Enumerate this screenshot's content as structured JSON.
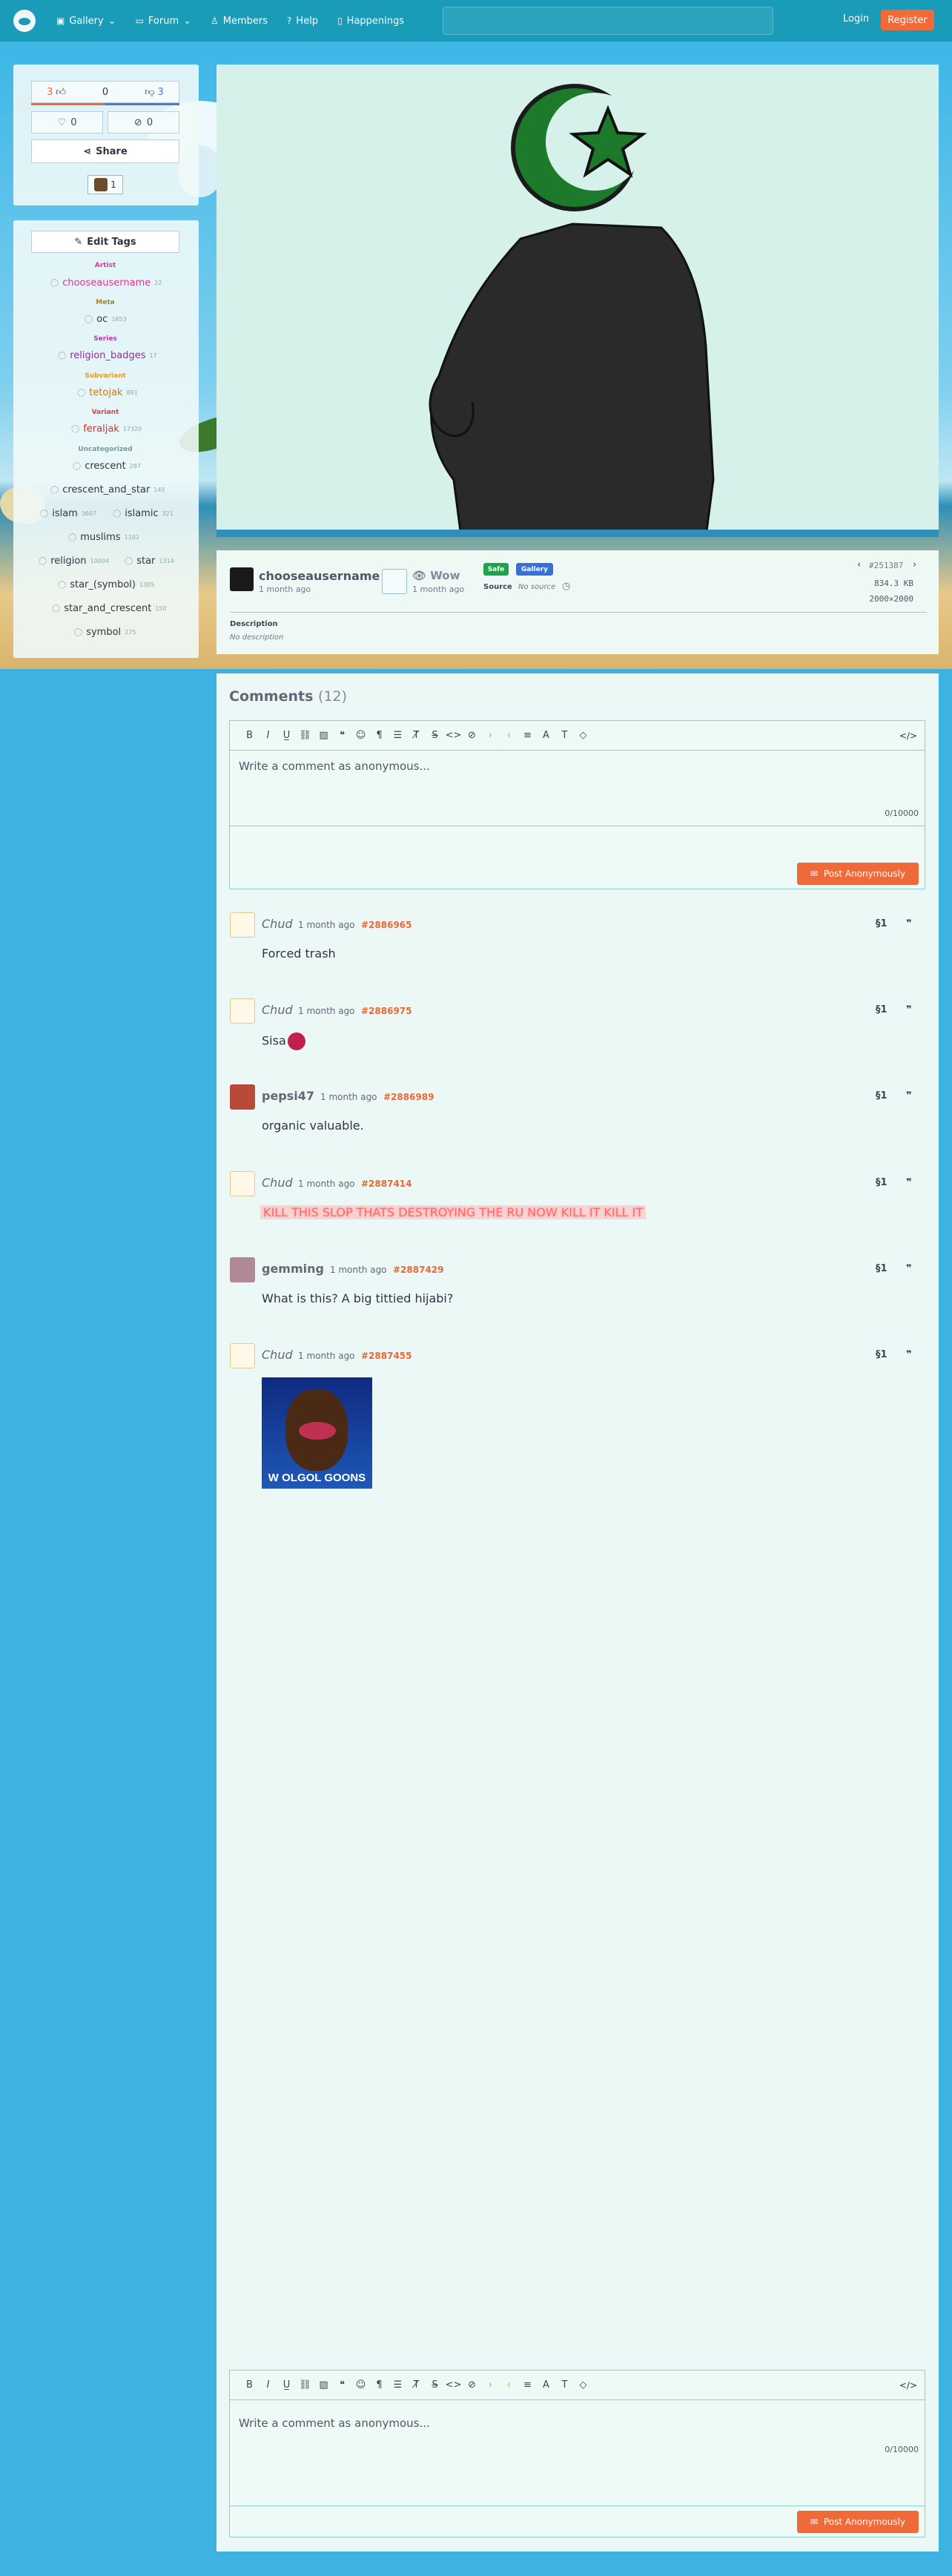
{
  "nav": {
    "items": [
      {
        "label": "Gallery",
        "icon": "image-icon",
        "dropdown": true
      },
      {
        "label": "Forum",
        "icon": "chat-icon",
        "dropdown": true
      },
      {
        "label": "Members",
        "icon": "user-icon"
      },
      {
        "label": "Help",
        "icon": "help-icon"
      },
      {
        "label": "Happenings",
        "icon": "book-icon"
      }
    ],
    "search_placeholder": "",
    "login": "Login",
    "register": "Register"
  },
  "votes": {
    "up": "3",
    "score": "0",
    "down": "3",
    "favorites": "0",
    "hides": "0"
  },
  "share": "Share",
  "favoriters_count": "1",
  "edit_tags": "Edit Tags",
  "tag_groups": [
    {
      "heading": "Artist",
      "color": "#e0339a",
      "tags": [
        {
          "name": "chooseausername",
          "count": "22",
          "color": "#e0339a"
        }
      ]
    },
    {
      "heading": "Meta",
      "color": "#a6822a",
      "tags": [
        {
          "name": "oc",
          "count": "1853",
          "color": "#334"
        }
      ]
    },
    {
      "heading": "Series",
      "color": "#b040b0",
      "tags": [
        {
          "name": "religion_badges",
          "count": "17",
          "color": "#903090"
        }
      ]
    },
    {
      "heading": "Subvariant",
      "color": "#e89a20",
      "tags": [
        {
          "name": "tetojak",
          "count": "891",
          "color": "#d07a10"
        }
      ]
    },
    {
      "heading": "Variant",
      "color": "#e04040",
      "tags": [
        {
          "name": "feraljak",
          "count": "17320",
          "color": "#d03030"
        }
      ]
    },
    {
      "heading": "Uncategorized",
      "color": "#7a9a9a",
      "tags": [
        {
          "name": "crescent",
          "count": "287",
          "color": "#334"
        },
        {
          "name": "crescent_and_star",
          "count": "145",
          "color": "#334"
        },
        {
          "name": "islam",
          "count": "3607",
          "color": "#334"
        },
        {
          "name": "islamic",
          "count": "321",
          "color": "#334"
        },
        {
          "name": "muslims",
          "count": "1102",
          "color": "#334"
        },
        {
          "name": "religion",
          "count": "10004",
          "color": "#334"
        },
        {
          "name": "star",
          "count": "1314",
          "color": "#334"
        },
        {
          "name": "star_(symbol)",
          "count": "1305",
          "color": "#334"
        },
        {
          "name": "star_and_crescent",
          "count": "150",
          "color": "#334"
        },
        {
          "name": "symbol",
          "count": "275",
          "color": "#334"
        }
      ]
    }
  ],
  "post": {
    "uploader": "chooseausername",
    "uploaded": "1 month ago",
    "approver": "Wow",
    "approved": "1 month ago",
    "rating": "Safe",
    "category": "Gallery",
    "source_label": "Source",
    "source_value": "No source",
    "id": "#251387",
    "size": "834.3 KB",
    "dimensions": "2000×2000",
    "description_label": "Description",
    "description": "No description"
  },
  "comments_title": "Comments",
  "comments_count": "(12)",
  "editor": {
    "placeholder": "Write a comment as anonymous...",
    "counter": "0/10000",
    "post_label": "Post Anonymously"
  },
  "comments": [
    {
      "name": "Chud",
      "time": "1 month ago",
      "id": "#2886965",
      "text": "Forced trash"
    },
    {
      "name": "Chud",
      "time": "1 month ago",
      "id": "#2886975",
      "text": "Sisa"
    },
    {
      "name": "pepsi47",
      "time": "1 month ago",
      "id": "#2886989",
      "text": "organic valuable."
    },
    {
      "name": "Chud",
      "time": "1 month ago",
      "id": "#2887414",
      "text": "KILL THIS SLOP THATS DESTROYING THE RU NOW KILL IT KILL IT"
    },
    {
      "name": "gemming",
      "time": "1 month ago",
      "id": "#2887429",
      "text": "What is this? A big tittied hijabi?"
    },
    {
      "name": "Chud",
      "time": "1 month ago",
      "id": "#2887455",
      "text": "",
      "image_caption": "W OLGOL GOONS"
    }
  ],
  "colors": {
    "accent": "#f06a3a",
    "nav": "#1a9bb8",
    "id_link": "#ee6633",
    "safe": "#1fa34a",
    "gallery": "#3a6fd8"
  }
}
